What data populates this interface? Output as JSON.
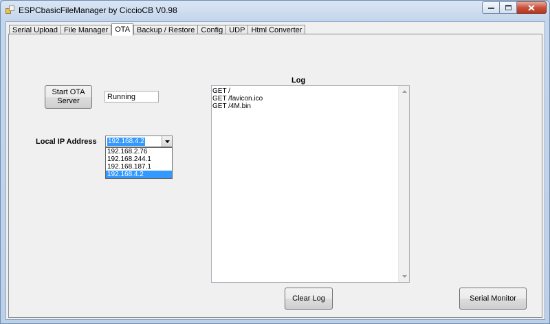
{
  "window": {
    "title": "ESPCbasicFileManager by CiccioCB V0.98",
    "controls": {
      "minimize": "minimize",
      "maximize": "maximize",
      "close": "close"
    }
  },
  "tabs": [
    {
      "label": "Serial Upload"
    },
    {
      "label": "File Manager"
    },
    {
      "label": "OTA",
      "active": true
    },
    {
      "label": "Backup / Restore"
    },
    {
      "label": "Config"
    },
    {
      "label": "UDP"
    },
    {
      "label": "Html Converter"
    }
  ],
  "ota": {
    "start_button_line1": "Start OTA",
    "start_button_line2": "Server",
    "status_value": "Running",
    "local_ip_label": "Local IP Address",
    "ip_selected": "192.168.4.2",
    "ip_options": [
      "192.168.2.76",
      "192.168.244.1",
      "192.168.187.1",
      "192.168.4.2"
    ],
    "log_label": "Log",
    "log_lines": [
      "GET /",
      "GET /favicon.ico",
      "GET /4M.bin"
    ],
    "clear_log_button": "Clear Log",
    "serial_monitor_button": "Serial Monitor"
  },
  "colors": {
    "selection": "#3399ff",
    "background": "#f0f0f0",
    "frame": "#b9d1ea"
  }
}
